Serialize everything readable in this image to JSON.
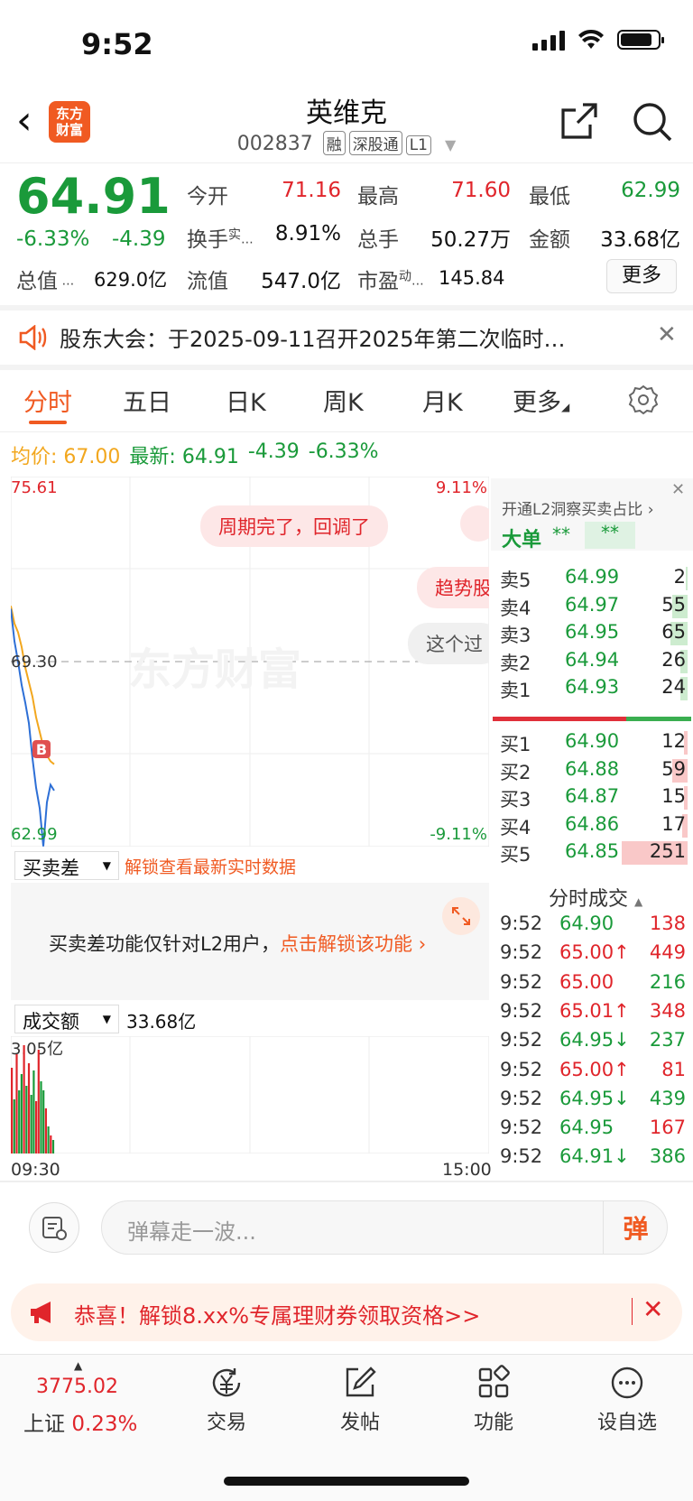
{
  "status": {
    "time": "9:52"
  },
  "header": {
    "title": "英维克",
    "code": "002837",
    "tags": [
      "融",
      "深股通",
      "L1"
    ]
  },
  "quote": {
    "price": "64.91",
    "change_pct": "-6.33%",
    "change": "-4.39",
    "open_label": "今开",
    "open": "71.16",
    "high_label": "最高",
    "high": "71.60",
    "low_label": "最低",
    "low": "62.99",
    "turnover_label": "换手",
    "turnover_sup": "实",
    "turnover": "8.91%",
    "volume_label": "总手",
    "volume": "50.27万",
    "amount_label": "金额",
    "amount": "33.68亿",
    "mcap_label": "总值",
    "mcap": "629.0亿",
    "float_label": "流值",
    "float": "547.0亿",
    "pe_label": "市盈",
    "pe_sup": "动",
    "pe": "145.84",
    "more": "更多"
  },
  "notice": {
    "text": "股东大会：于2025-09-11召开2025年第二次临时…"
  },
  "tabs": [
    {
      "label": "分时"
    },
    {
      "label": "五日"
    },
    {
      "label": "日K"
    },
    {
      "label": "周K"
    },
    {
      "label": "月K"
    },
    {
      "label": "更多"
    }
  ],
  "avg": {
    "avg_label": "均价:",
    "avg": "67.00",
    "latest_label": "最新:",
    "latest": "64.91",
    "chg": "-4.39",
    "pct": "-6.33%"
  },
  "chart": {
    "top": "75.61",
    "mid": "69.30",
    "bottom": "62.99",
    "top_pct": "9.11%",
    "bottom_pct": "-9.11%",
    "watermark": "东方财富",
    "b_marker": "B",
    "bubbles": [
      "周期完了，回调了",
      "趋势股",
      "这个过"
    ],
    "time_start": "09:30",
    "time_end": "15:00"
  },
  "chart_data": {
    "type": "line",
    "series": [
      {
        "name": "",
        "values": [
          71.2,
          70.6,
          70.3,
          69.8,
          69.1,
          68.6,
          68.1,
          67.4,
          66.9,
          66.4,
          66.1,
          65.9,
          65.8
        ]
      },
      {
        "name": "",
        "values": [
          71.1,
          70.0,
          69.3,
          68.5,
          67.9,
          67.2,
          66.0,
          65.0,
          64.3,
          63.0,
          64.5,
          65.1,
          64.9
        ]
      }
    ],
    "ylim": [
      62.99,
      75.61
    ],
    "volume_max_label": "3.05亿"
  },
  "depth": {
    "banner": "开通L2洞察买卖占比",
    "big_order_label": "大单",
    "big_order_a": "**",
    "big_order_b": "**",
    "sells": [
      {
        "label": "卖5",
        "price": "64.99",
        "vol": "2",
        "w": 0.01
      },
      {
        "label": "卖4",
        "price": "64.97",
        "vol": "55",
        "w": 0.08
      },
      {
        "label": "卖3",
        "price": "64.95",
        "vol": "65",
        "w": 0.09
      },
      {
        "label": "卖2",
        "price": "64.94",
        "vol": "26",
        "w": 0.04
      },
      {
        "label": "卖1",
        "price": "64.93",
        "vol": "24",
        "w": 0.04
      }
    ],
    "buys": [
      {
        "label": "买1",
        "price": "64.90",
        "vol": "12",
        "w": 0.02
      },
      {
        "label": "买2",
        "price": "64.88",
        "vol": "59",
        "w": 0.08
      },
      {
        "label": "买3",
        "price": "64.87",
        "vol": "15",
        "w": 0.02
      },
      {
        "label": "买4",
        "price": "64.86",
        "vol": "17",
        "w": 0.03
      },
      {
        "label": "买5",
        "price": "64.85",
        "vol": "251",
        "w": 0.35
      }
    ],
    "trades_title": "分时成交",
    "trades": [
      {
        "t": "9:52",
        "p": "64.90",
        "a": "",
        "v": "138",
        "pc": "green",
        "vc": "red"
      },
      {
        "t": "9:52",
        "p": "65.00",
        "a": "↑",
        "v": "449",
        "pc": "red",
        "vc": "red"
      },
      {
        "t": "9:52",
        "p": "65.00",
        "a": "",
        "v": "216",
        "pc": "red",
        "vc": "green"
      },
      {
        "t": "9:52",
        "p": "65.01",
        "a": "↑",
        "v": "348",
        "pc": "red",
        "vc": "red"
      },
      {
        "t": "9:52",
        "p": "64.95",
        "a": "↓",
        "v": "237",
        "pc": "green",
        "vc": "green"
      },
      {
        "t": "9:52",
        "p": "65.00",
        "a": "↑",
        "v": "81",
        "pc": "red",
        "vc": "red"
      },
      {
        "t": "9:52",
        "p": "64.95",
        "a": "↓",
        "v": "439",
        "pc": "green",
        "vc": "green"
      },
      {
        "t": "9:52",
        "p": "64.95",
        "a": "",
        "v": "167",
        "pc": "green",
        "vc": "red"
      },
      {
        "t": "9:52",
        "p": "64.91",
        "a": "↓",
        "v": "386",
        "pc": "green",
        "vc": "green"
      }
    ]
  },
  "diff": {
    "select": "买卖差",
    "hint": "解锁查看最新实时数据",
    "text": "买卖差功能仅针对L2用户，",
    "link": "点击解锁该功能"
  },
  "volume": {
    "select": "成交额",
    "value": "33.68亿"
  },
  "danmu": {
    "placeholder": "弹幕走一波...",
    "btn": "弹"
  },
  "promo": {
    "text": "恭喜！解锁8.xx%专属理财券领取资格>>"
  },
  "nav": {
    "index_value": "3775.02",
    "index_name": "上证",
    "index_pct": "0.23%",
    "items": [
      "交易",
      "发帖",
      "功能",
      "设自选"
    ]
  }
}
